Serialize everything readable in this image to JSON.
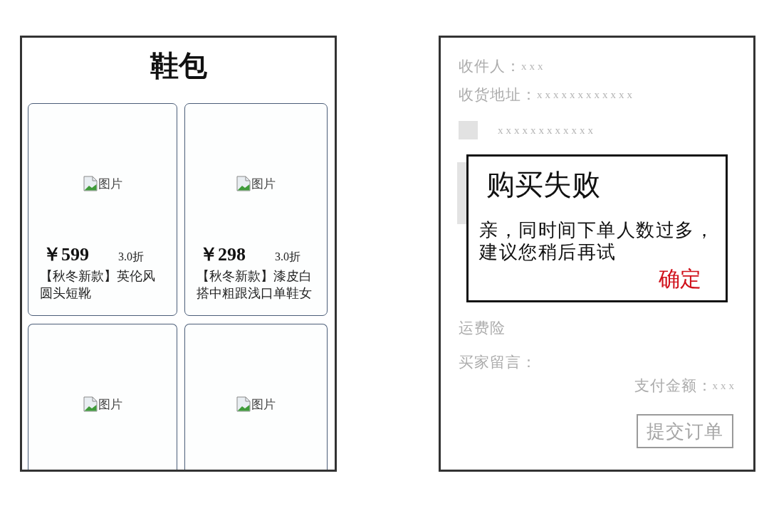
{
  "shoes_page": {
    "title": "鞋包",
    "products": [
      {
        "image_alt": "图片",
        "price": "￥599",
        "discount": "3.0折",
        "name": "【秋冬新款】英伦风圆头短靴"
      },
      {
        "image_alt": "图片",
        "price": "￥298",
        "discount": "3.0折",
        "name": "【秋冬新款】漆皮白搭中粗跟浅口单鞋女"
      },
      {
        "image_alt": "图片"
      },
      {
        "image_alt": "图片"
      }
    ]
  },
  "order_page": {
    "recipient": {
      "label": "收件人：",
      "value": "xxx"
    },
    "address": {
      "label": "收货地址：",
      "value": "xxxxxxxxxxxx"
    },
    "item": {
      "text": "xxxxxxxxxxxx"
    },
    "shipping_insurance": "运费险",
    "buyer_message": "买家留言：",
    "payment": {
      "label": "支付金额：",
      "value": "xxx"
    },
    "submit_button": "提交订单",
    "dialog": {
      "title": "购买失败",
      "message": "亲，同时间下单人数过多，建议您稍后再试",
      "confirm": "确定"
    }
  }
}
